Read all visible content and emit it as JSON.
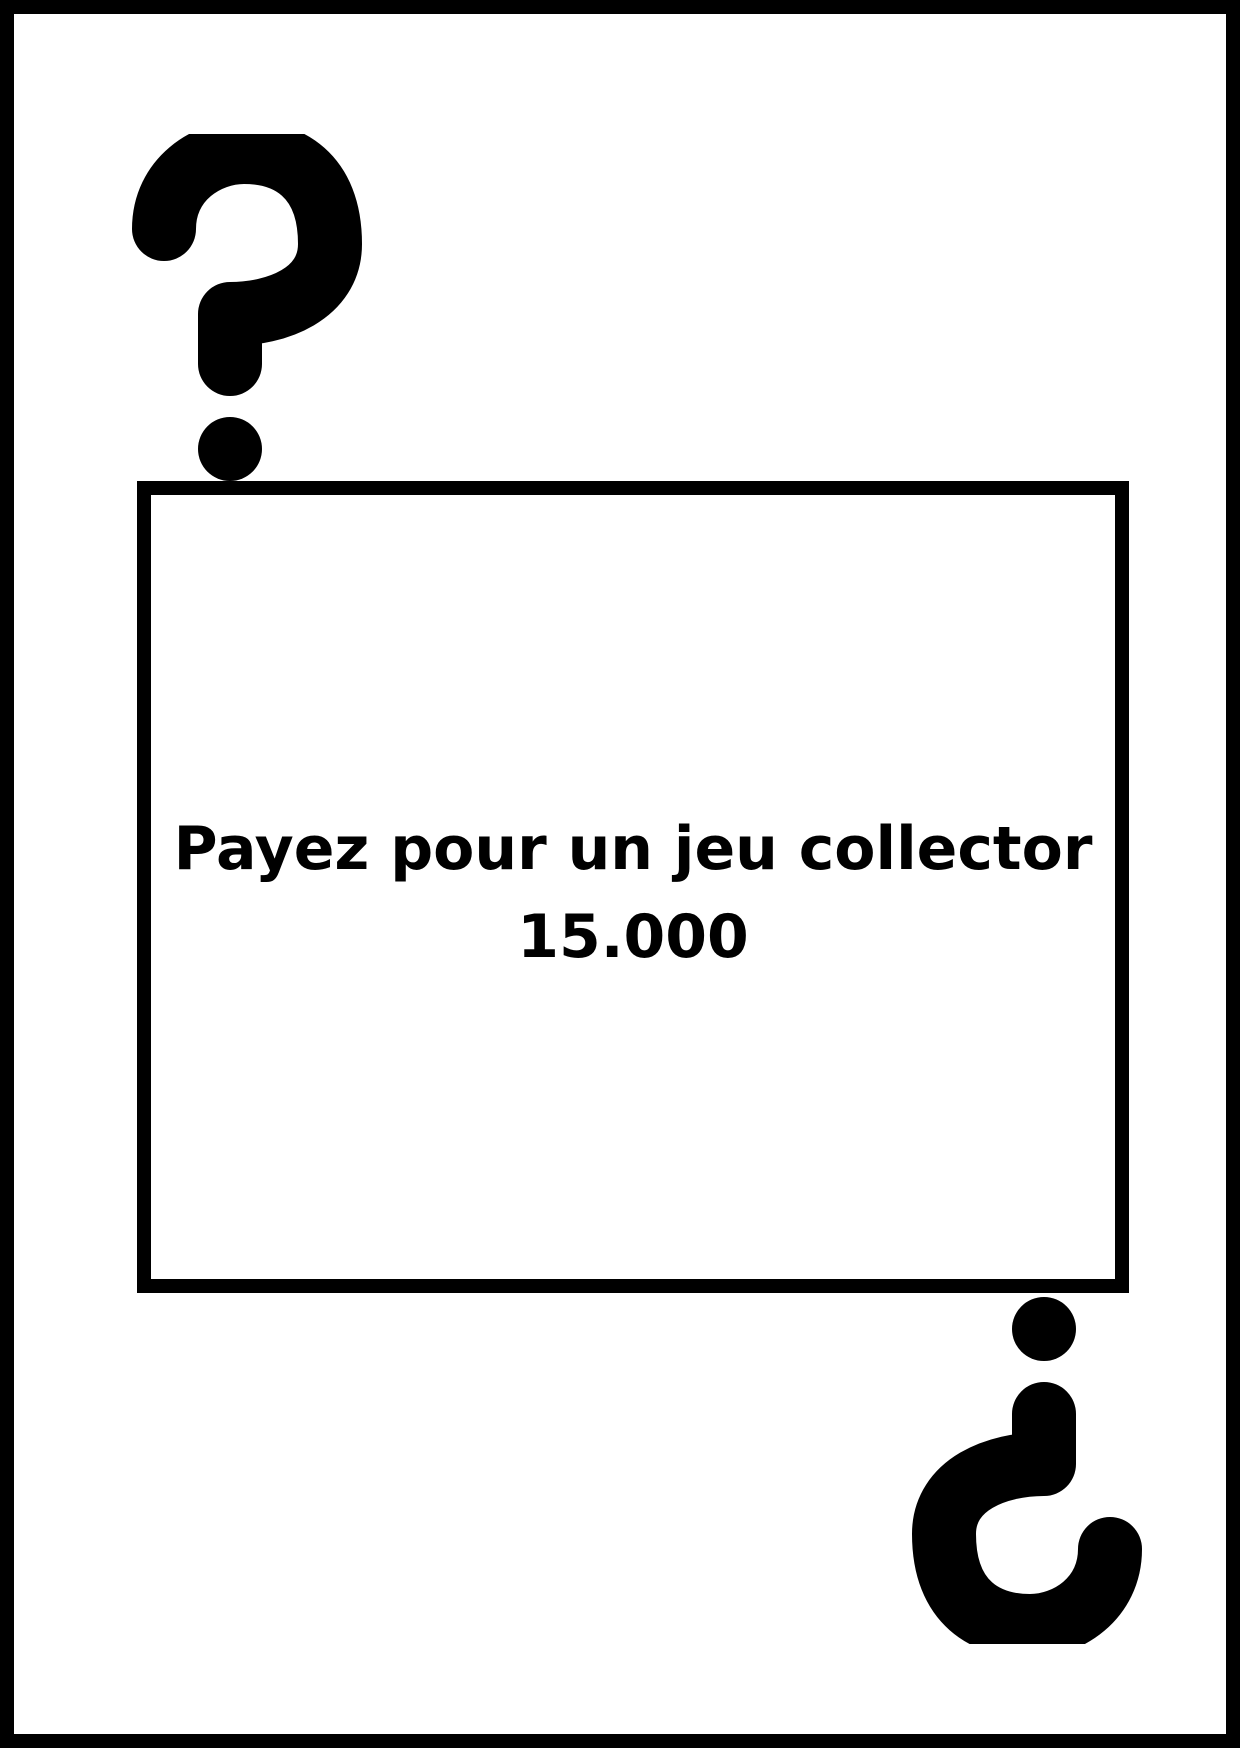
{
  "card": {
    "message_line1": "Payez pour un jeu collector",
    "message_line2": "15.000"
  },
  "icons": {
    "top": "question-mark-icon",
    "bottom": "inverted-question-mark-icon"
  },
  "colors": {
    "ink": "#000000",
    "paper": "#ffffff"
  }
}
